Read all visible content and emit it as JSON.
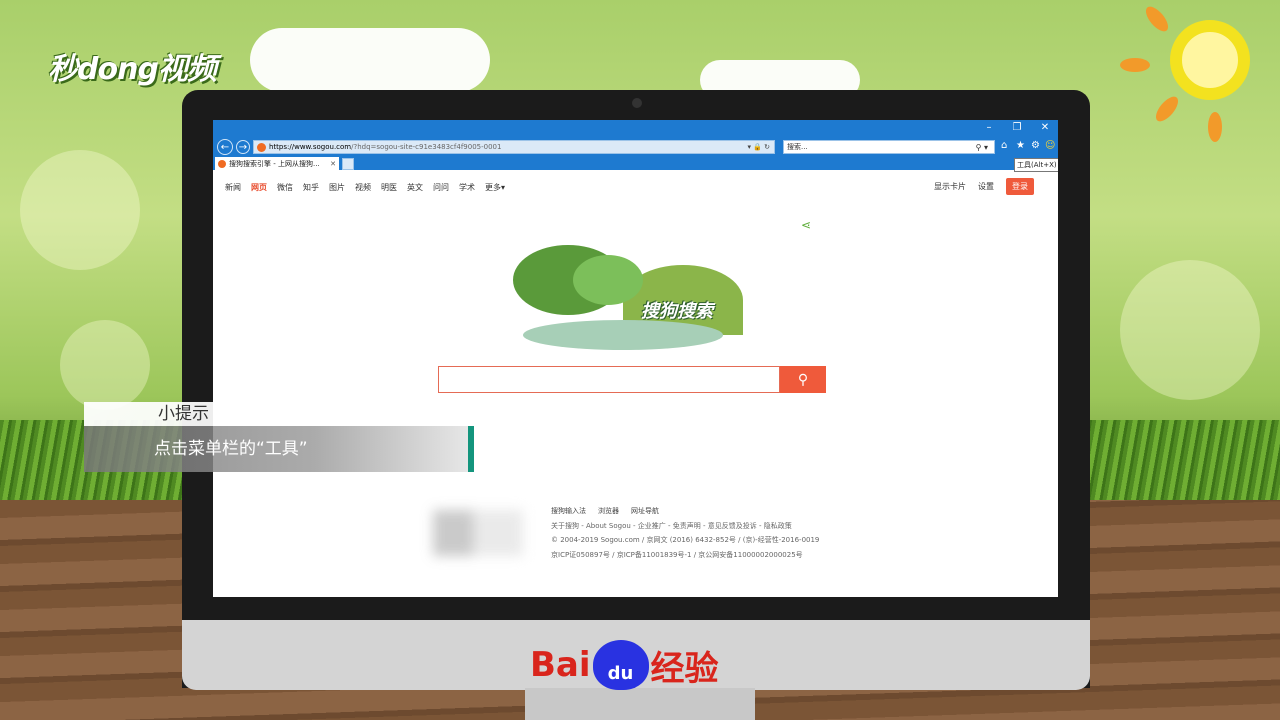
{
  "brand": {
    "video_logo": "秒dong视频",
    "baidu_text_left": "Bai",
    "baidu_paw": "du",
    "baidu_text_right": "经验"
  },
  "browser": {
    "address": {
      "host": "https://www.sogou.com",
      "path": "/?hdq=sogou-site-c91e3483cf4f9005-0001"
    },
    "search_placeholder": "搜索...",
    "tab_title": "搜狗搜索引擎 - 上网从搜狗...",
    "tooltip": "工具(Alt+X)"
  },
  "sogou": {
    "nav": [
      "新闻",
      "网页",
      "微信",
      "知乎",
      "图片",
      "视频",
      "明医",
      "英文",
      "问问",
      "学术",
      "更多▾"
    ],
    "active_index": 1,
    "right_links": {
      "card": "显示卡片",
      "settings": "设置",
      "login": "登录"
    },
    "doodle_text": "搜狗搜索",
    "footer": {
      "links": [
        "搜狗输入法",
        "浏览器",
        "网址导航"
      ],
      "line1": "关于搜狗 - About Sogou - 企业推广 - 免责声明 - 意见反馈及投诉 - 隐私政策",
      "line2": "© 2004-2019 Sogou.com / 京网文 (2016) 6432-852号 / (京)-经营性-2016-0019",
      "line3": "京ICP证050897号 / 京ICP备11001839号-1 / 京公网安备11000002000025号"
    }
  },
  "tip": {
    "heading": "小提示",
    "body": "点击菜单栏的“工具”"
  },
  "colors": {
    "accent": "#ef5a3b",
    "ie_blue": "#1e7ad0",
    "tip_bar": "#14957d"
  }
}
